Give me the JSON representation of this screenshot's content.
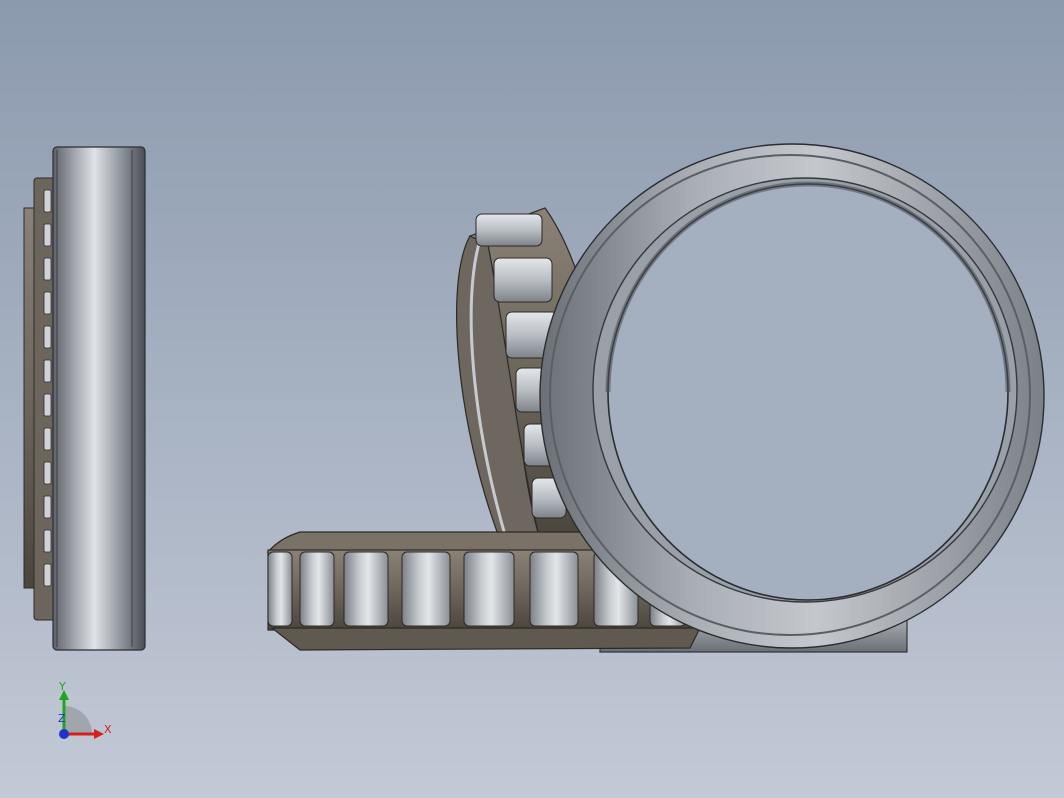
{
  "viewport": {
    "background_top": "#8c9aae",
    "background_bottom": "#c3c9d6"
  },
  "scene": {
    "objects": [
      "side-view-bearing",
      "roller-cone-assembly-tilted",
      "roller-cone-assembly-flat",
      "outer-cup-ring-upright",
      "outer-cup-ring-flat"
    ],
    "colors": {
      "steel_light": "#d9dde2",
      "steel_mid": "#9ea4ab",
      "steel_dark": "#4e5258",
      "cage_bronze": "#7a7266",
      "cage_dark": "#3f3a34"
    }
  },
  "triad": {
    "x_label": "X",
    "y_label": "Y",
    "z_label": "Z",
    "x_color": "#d62020",
    "y_color": "#1fa61f",
    "z_color": "#2233cc"
  }
}
